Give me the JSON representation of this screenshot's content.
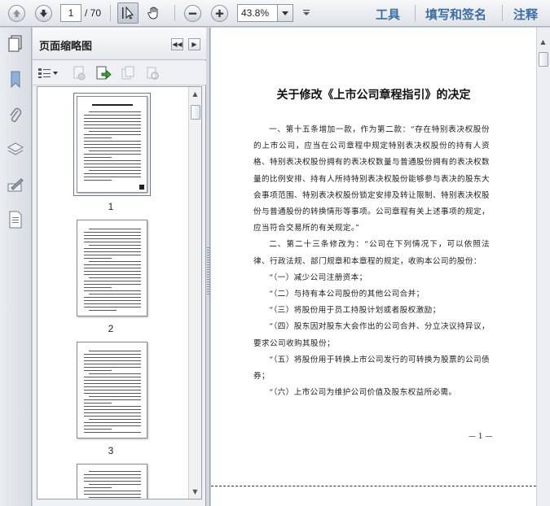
{
  "toolbar": {
    "current_page": "1",
    "total_pages": "/ 70",
    "zoom": "43.8%",
    "tools_label": "工具",
    "fill_sign_label": "填写和签名",
    "comment_label": "注释"
  },
  "thumbnail_panel": {
    "title": "页面缩略图",
    "pages": [
      "1",
      "2",
      "3"
    ]
  },
  "document": {
    "title": "关于修改《上市公司章程指引》的决定",
    "paragraphs": [
      "一、第十五条增加一款，作为第二款：“存在特别表决权股份的上市公司，应当在公司章程中规定特别表决权股份的持有人资格、特别表决权股份拥有的表决权数量与普通股份拥有的表决权数量的比例安排、持有人所持特别表决权股份能够参与表决的股东大会事项范围、特别表决权股份锁定安排及转让限制、特别表决权股份与普通股份的转换情形等事项。公司章程有关上述事项的规定，应当符合交易所的有关规定。”",
      "二、第二十三条修改为：“公司在下列情况下，可以依照法律、行政法规、部门规章和本章程的规定，收购本公司的股份：",
      "“（一）减少公司注册资本；",
      "“（二）与持有本公司股份的其他公司合并；",
      "“（三）将股份用于员工持股计划或者股权激励；",
      "“（四）股东因对股东大会作出的公司合并、分立决议持异议，要求公司收购其股份；",
      "“（五）将股份用于转换上市公司发行的可转换为股票的公司债券；",
      "“（六）上市公司为维护公司价值及股东权益所必需。"
    ],
    "page_number": "— 1 —"
  }
}
